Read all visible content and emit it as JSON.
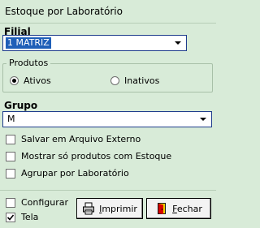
{
  "window": {
    "title": "Estoque por Laboratório"
  },
  "filial": {
    "label": "Filial",
    "value": "1 MATRIZ"
  },
  "produtos": {
    "legend": "Produtos",
    "options": [
      {
        "label": "Ativos",
        "selected": true
      },
      {
        "label": "Inativos",
        "selected": false
      }
    ]
  },
  "grupo": {
    "label": "Grupo",
    "value": "M"
  },
  "options": [
    {
      "label": "Salvar em Arquivo Externo",
      "checked": false
    },
    {
      "label": "Mostrar só produtos com Estoque",
      "checked": false
    },
    {
      "label": "Agrupar por Laboratório",
      "checked": false
    }
  ],
  "footer": {
    "configurar": {
      "label": "Configurar",
      "checked": false
    },
    "tela": {
      "label": "Tela",
      "checked": true
    },
    "imprimir": {
      "first": "I",
      "rest": "mprimir"
    },
    "fechar": {
      "first": "F",
      "rest": "echar"
    }
  },
  "icons": {
    "print": "printer-icon",
    "close": "exit-door-icon"
  }
}
